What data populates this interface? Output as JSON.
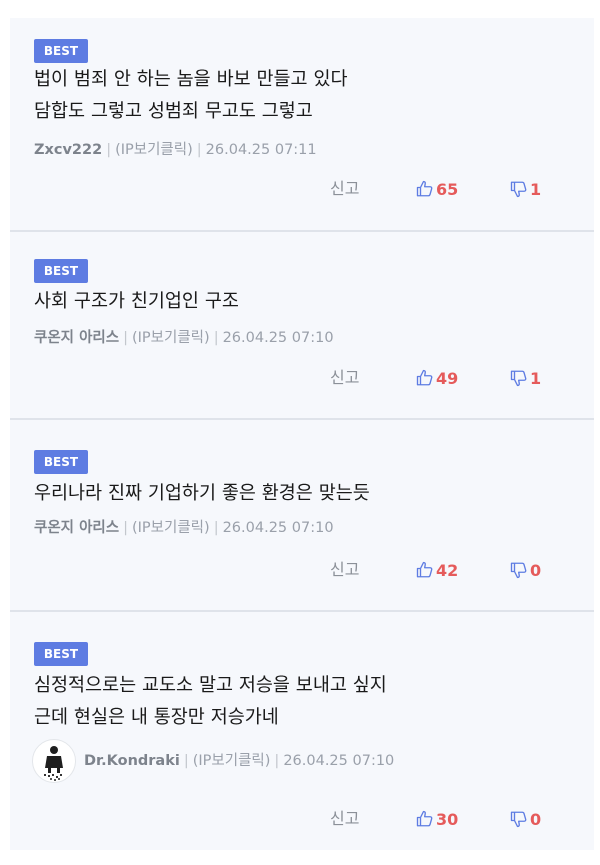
{
  "comments": [
    {
      "badge": "BEST",
      "lines": [
        "법이 범죄 안 하는 놈을 바보 만들고 있다",
        "담합도 그렇고 성범죄 무고도 그렇고"
      ],
      "author": "Zxcv222",
      "ip": "(IP보기클릭)",
      "date": "26.04.25 07:11",
      "report": "신고",
      "likes": "65",
      "dislikes": "1"
    },
    {
      "badge": "BEST",
      "lines": [
        "사회 구조가 친기업인 구조"
      ],
      "author": "쿠온지 아리스",
      "ip": "(IP보기클릭)",
      "date": "26.04.25 07:10",
      "report": "신고",
      "likes": "49",
      "dislikes": "1"
    },
    {
      "badge": "BEST",
      "lines": [
        "우리나라 진짜 기업하기 좋은 환경은 맞는듯"
      ],
      "author": "쿠온지 아리스",
      "ip": "(IP보기클릭)",
      "date": "26.04.25 07:10",
      "report": "신고",
      "likes": "42",
      "dislikes": "0"
    },
    {
      "badge": "BEST",
      "lines": [
        "심정적으로는 교도소 말고 저승을 보내고 싶지",
        "근데 현실은 내 통장만 저승가네"
      ],
      "author": "Dr.Kondraki",
      "ip": "(IP보기클릭)",
      "date": "26.04.25 07:10",
      "report": "신고",
      "likes": "30",
      "dislikes": "0"
    }
  ],
  "icons": {
    "like": "thumbs-up-icon",
    "dislike": "thumbs-down-icon",
    "avatar": "user-avatar"
  },
  "colors": {
    "badge": "#5e7ce2",
    "vote": "#e55b5b",
    "background": "#f6f8fc"
  }
}
